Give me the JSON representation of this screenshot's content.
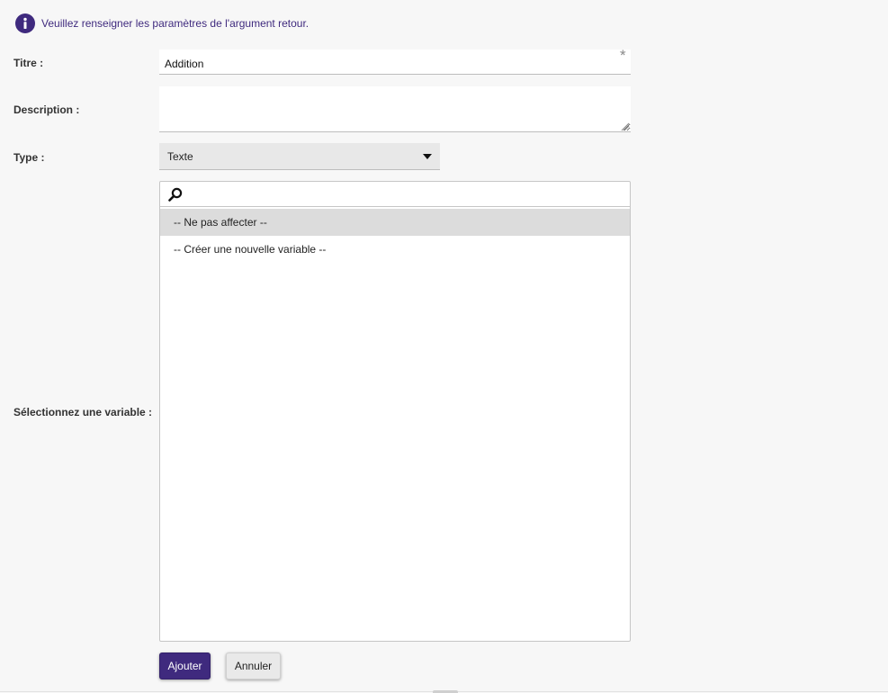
{
  "info": {
    "icon": "info-icon",
    "message": "Veuillez renseigner les paramètres de l'argument retour."
  },
  "form": {
    "title": {
      "label": "Titre :",
      "value": "Addition",
      "required_marker": "*"
    },
    "description": {
      "label": "Description :",
      "value": ""
    },
    "type": {
      "label": "Type :",
      "selected": "Texte"
    },
    "variable": {
      "label": "Sélectionnez une variable :",
      "search_value": "",
      "options": [
        {
          "label": "-- Ne pas affecter --",
          "selected": true
        },
        {
          "label": "-- Créer une nouvelle variable --",
          "selected": false
        }
      ]
    }
  },
  "actions": {
    "add_label": "Ajouter",
    "cancel_label": "Annuler"
  },
  "colors": {
    "accent": "#3f2a7e",
    "selected_option_bg": "#dcdcdc",
    "select_bg": "#e8e8e8",
    "page_bg": "#f7f7f7"
  }
}
